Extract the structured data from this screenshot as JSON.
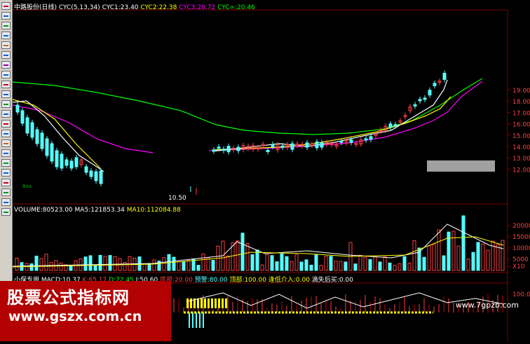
{
  "header": {
    "stock": "中路股份(日线)",
    "cyc": "CYC(5,13,34)",
    "cyc1": "CYC1:23.40",
    "cyc2": "CYC2:22.38",
    "cyc3": "CYC3:20.72",
    "cycinf": "CYC∞:20.46"
  },
  "volume_header": {
    "vol": "VOLUME:80523.00",
    "ma5": "MA5:121853.34",
    "ma10": "MA10:112084.88"
  },
  "indicator_header": {
    "name": "小保专用",
    "macd": "MACD:10.37",
    "k": "K:65.17",
    "d": "D:72.45",
    "j": "J:50.60",
    "bottom": "底部:20.00",
    "warn": "预警:80.00",
    "top": "顶部:100.00",
    "buy": "逢低介入:0.00",
    "sell": "滴失后买:0.00"
  },
  "price_axis": [
    "19.00",
    "18.00",
    "17.00",
    "16.00",
    "15.00",
    "14.00",
    "13.00",
    "12.00"
  ],
  "volume_axis": [
    "20000",
    "15000",
    "10000",
    "5000",
    "X10"
  ],
  "indicator_axis": [
    "100.00"
  ],
  "annotation_low": "10.50",
  "annotation_red": "8ea",
  "watermark": {
    "title": "股票公式指标网",
    "url": "www.gszx.com.cn",
    "corner": "www.7gpzb.com"
  },
  "colors": {
    "up": "#ff4040",
    "down": "#54ffff",
    "cyc1": "#ffffff",
    "cyc2": "#ffff00",
    "cyc3": "#ff00ff",
    "cycinf": "#00ff00",
    "grid": "#800000"
  }
}
